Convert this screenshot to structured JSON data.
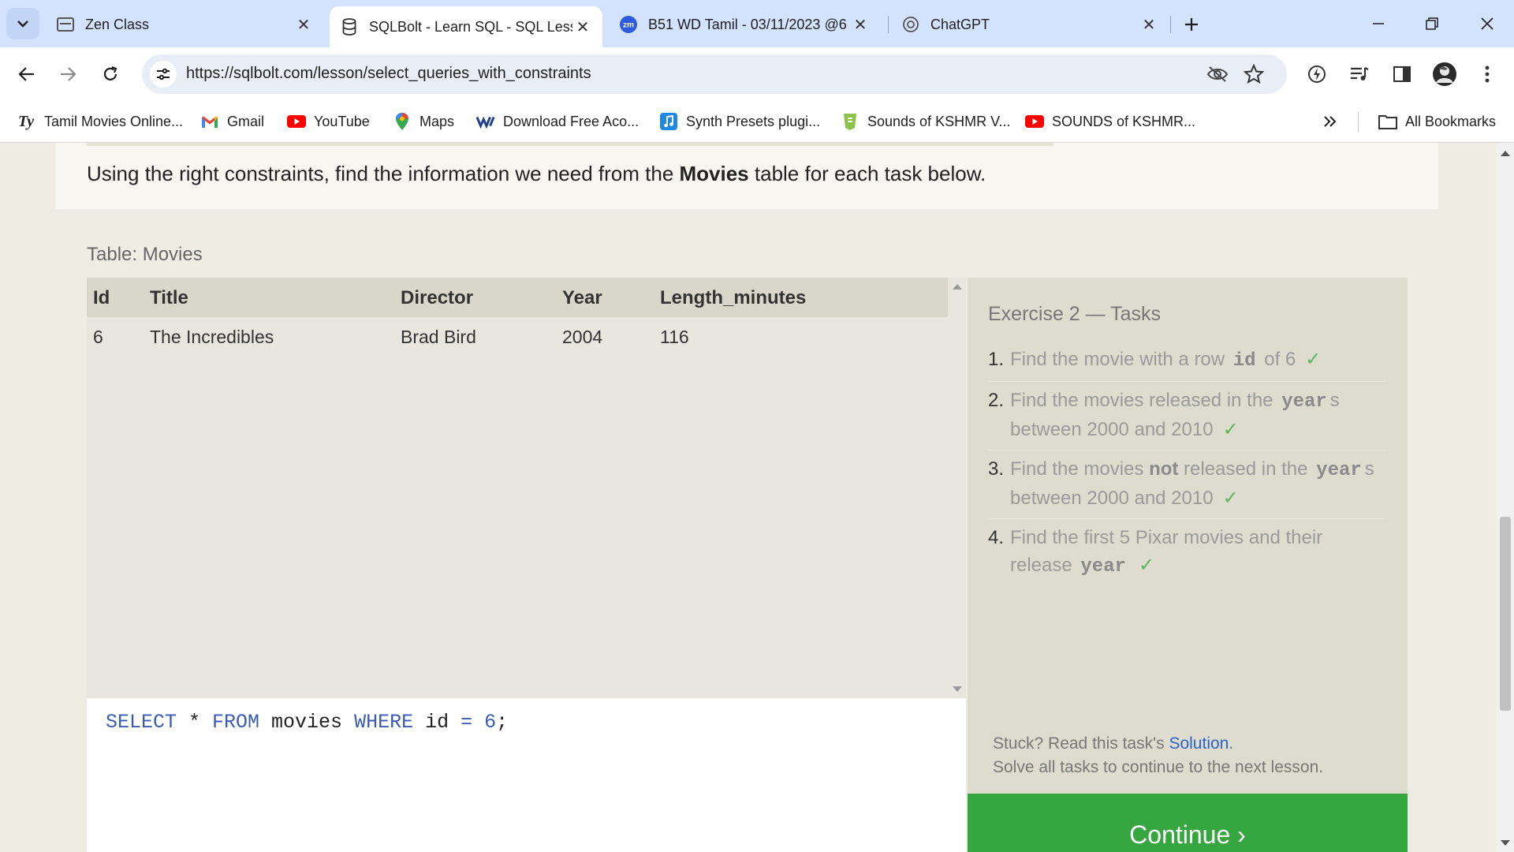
{
  "tabs": [
    {
      "title": "Zen Class",
      "active": false
    },
    {
      "title": "SQLBolt - Learn SQL - SQL Less",
      "active": true
    },
    {
      "title": "B51 WD Tamil - 03/11/2023 @6",
      "active": false
    },
    {
      "title": "ChatGPT",
      "active": false
    }
  ],
  "address": {
    "url": "https://sqlbolt.com/lesson/select_queries_with_constraints"
  },
  "bookmarks": [
    {
      "label": "Tamil Movies Online...",
      "icon": "ty-icon"
    },
    {
      "label": "Gmail",
      "icon": "gmail-icon"
    },
    {
      "label": "YouTube",
      "icon": "youtube-icon"
    },
    {
      "label": "Maps",
      "icon": "maps-icon"
    },
    {
      "label": "Download Free Aco...",
      "icon": "download-icon"
    },
    {
      "label": "Synth Presets plugi...",
      "icon": "music-icon"
    },
    {
      "label": "Sounds of KSHMR V...",
      "icon": "sounds-icon"
    },
    {
      "label": "SOUNDS of KSHMR...",
      "icon": "youtube-icon"
    }
  ],
  "all_bookmarks": "All Bookmarks",
  "page": {
    "intro_before": "Using the right constraints, find the information we need from the ",
    "intro_bold": "Movies",
    "intro_after": " table for each task below.",
    "table_caption": "Table: Movies",
    "columns": [
      "Id",
      "Title",
      "Director",
      "Year",
      "Length_minutes"
    ],
    "rows": [
      [
        "6",
        "The Incredibles",
        "Brad Bird",
        "2004",
        "116"
      ]
    ],
    "query": {
      "t1": "SELECT",
      "t2": " * ",
      "t3": "FROM",
      "t4": " movies ",
      "t5": "WHERE",
      "t6": " id ",
      "t7": "=",
      "t8": " ",
      "t9": "6",
      "t10": ";"
    },
    "tasks_title": "Exercise 2 — Tasks",
    "tasks": [
      {
        "num": "1.",
        "a": "Find the movie with a row ",
        "kw": "id",
        "b": " of 6",
        "check": "✓"
      },
      {
        "num": "2.",
        "a": "Find the movies released in the ",
        "kw": "year",
        "b": "s between 2000 and 2010",
        "check": "✓"
      },
      {
        "num": "3.",
        "a": "Find the movies ",
        "strong": "not",
        "a2": " released in the ",
        "kw": "year",
        "b": "s between 2000 and 2010",
        "check": "✓"
      },
      {
        "num": "4.",
        "a": "Find the first 5 Pixar movies and their release ",
        "kw": "year",
        "b": "",
        "check": "✓"
      }
    ],
    "stuck_text": "Stuck? Read this task's ",
    "solution_link": "Solution",
    "stuck_end": ".",
    "solve_all": "Solve all tasks to continue to the next lesson.",
    "continue_label": "Continue ›"
  }
}
